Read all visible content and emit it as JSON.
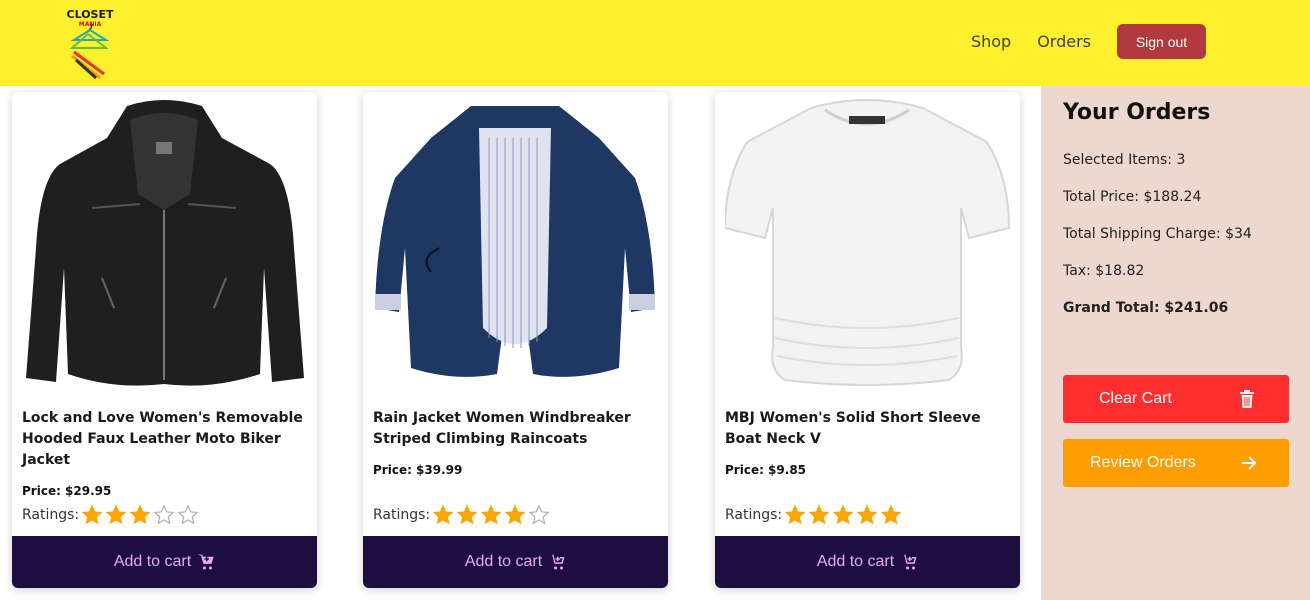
{
  "header": {
    "logo_text": "CLOSET",
    "logo_subtext": "MANIA",
    "nav": [
      "Shop",
      "Orders"
    ],
    "signout_label": "Sign out"
  },
  "products": [
    {
      "title": "Lock and Love Women's Removable Hooded Faux Leather Moto Biker Jacket",
      "price": "Price: $29.95",
      "ratings_label": "Ratings:",
      "rating": 3,
      "add_label": "Add to cart"
    },
    {
      "title": "Rain Jacket Women Windbreaker Striped Climbing Raincoats",
      "price": "Price: $39.99",
      "ratings_label": "Ratings:",
      "rating": 4,
      "add_label": "Add to cart"
    },
    {
      "title": "MBJ Women's Solid Short Sleeve Boat Neck V",
      "price": "Price: $9.85",
      "ratings_label": "Ratings:",
      "rating": 5,
      "add_label": "Add to cart"
    }
  ],
  "summary": {
    "title": "Your Orders",
    "selected": "Selected Items: 3",
    "total_price": "Total Price: $188.24",
    "shipping": "Total Shipping Charge: $34",
    "tax": "Tax: $18.82",
    "grand_total": "Grand Total: $241.06",
    "clear_label": "Clear Cart",
    "review_label": "Review Orders"
  },
  "colors": {
    "header_bg": "#FFF02E",
    "signout_bg": "#B03A3F",
    "cart_button_bg": "#1D0E3F",
    "cart_button_text": "#E9A7FF",
    "summary_bg": "#EDD7CF",
    "clear_bg": "#FF2E2E",
    "review_bg": "#FF9C00",
    "star": "#FFA500"
  }
}
